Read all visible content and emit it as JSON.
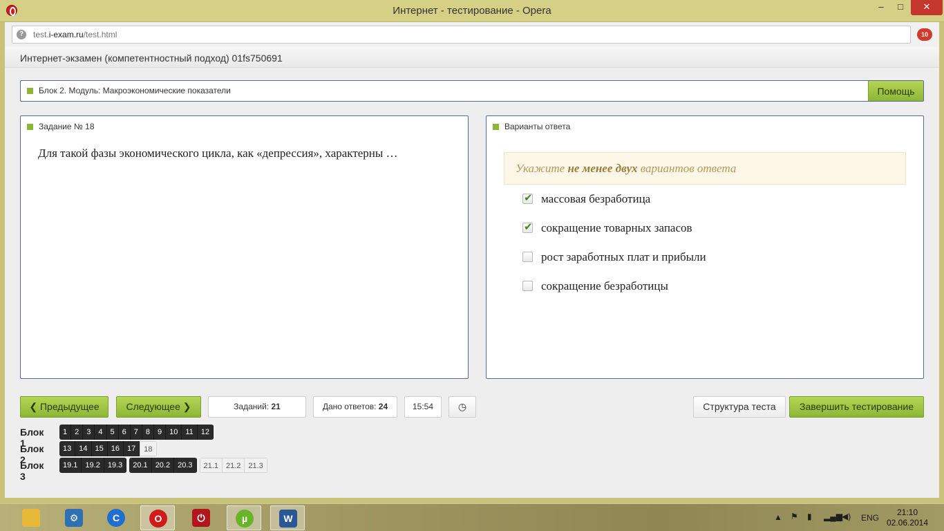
{
  "window": {
    "title": "Интернет - тестирование - Opera",
    "minimize": "–",
    "maximize": "□",
    "close": "✕"
  },
  "browser": {
    "url_prefix": "test.",
    "url_domain": "i-exam.ru",
    "url_path": "/test.html",
    "extension_badge": "10"
  },
  "page": {
    "header": "Интернет-экзамен (компетентностный подход) 01fs750691",
    "block_title": "Блок 2. Модуль: Макроэкономические показатели",
    "help_label": "Помощь",
    "task_title": "Задание № 18",
    "task_text": "Для такой фазы экономического цикла, как «депрессия», характерны …",
    "answers_title": "Варианты ответа",
    "hint_pre": "Укажите ",
    "hint_bold": "не менее двух",
    "hint_post": " вариантов ответа",
    "options": [
      {
        "label": "массовая безработица",
        "checked": true
      },
      {
        "label": "сокращение товарных запасов",
        "checked": true
      },
      {
        "label": "рост заработных плат и прибыли",
        "checked": false
      },
      {
        "label": "сокращение безработицы",
        "checked": false
      }
    ]
  },
  "controls": {
    "prev_label": "Предыдущее",
    "next_label": "Следующее",
    "tasks_label": "Заданий:",
    "tasks_count": "21",
    "answered_label": "Дано ответов:",
    "answered_count": "24",
    "timer": "15:54",
    "structure_label": "Структура теста",
    "finish_label": "Завершить тестирование"
  },
  "navigation": [
    {
      "label": "Блок 1",
      "groups": [
        [
          {
            "n": "1",
            "done": true
          },
          {
            "n": "2",
            "done": true
          },
          {
            "n": "3",
            "done": true
          },
          {
            "n": "4",
            "done": true
          },
          {
            "n": "5",
            "done": true
          },
          {
            "n": "6",
            "done": true
          },
          {
            "n": "7",
            "done": true
          },
          {
            "n": "8",
            "done": true
          },
          {
            "n": "9",
            "done": true
          },
          {
            "n": "10",
            "done": true
          },
          {
            "n": "11",
            "done": true
          },
          {
            "n": "12",
            "done": true
          }
        ]
      ]
    },
    {
      "label": "Блок 2",
      "groups": [
        [
          {
            "n": "13",
            "done": true
          },
          {
            "n": "14",
            "done": true
          },
          {
            "n": "15",
            "done": true
          },
          {
            "n": "16",
            "done": true
          },
          {
            "n": "17",
            "done": true
          },
          {
            "n": "18",
            "done": false
          }
        ]
      ]
    },
    {
      "label": "Блок 3",
      "groups": [
        [
          {
            "n": "19.1",
            "done": true
          },
          {
            "n": "19.2",
            "done": true
          },
          {
            "n": "19.3",
            "done": true
          }
        ],
        [
          {
            "n": "20.1",
            "done": true
          },
          {
            "n": "20.2",
            "done": true
          },
          {
            "n": "20.3",
            "done": true
          }
        ],
        [
          {
            "n": "21.1",
            "done": false
          },
          {
            "n": "21.2",
            "done": false
          },
          {
            "n": "21.3",
            "done": false
          }
        ]
      ]
    }
  ],
  "taskbar": {
    "apps": [
      {
        "name": "file-explorer-icon",
        "glyph": "",
        "color": "#e8b838"
      },
      {
        "name": "control-panel-icon",
        "glyph": "⚙",
        "color": "#2f6fb3"
      },
      {
        "name": "ccleaner-icon",
        "glyph": "C",
        "color": "#1e6fd1"
      },
      {
        "name": "opera-icon",
        "glyph": "O",
        "color": "#d01b1b"
      },
      {
        "name": "power-icon",
        "glyph": "⏻",
        "color": "#b0161c"
      },
      {
        "name": "utorrent-icon",
        "glyph": "µ",
        "color": "#6ab42a"
      },
      {
        "name": "word-icon",
        "glyph": "W",
        "color": "#2b5797"
      }
    ],
    "language": "ENG",
    "time": "21:10",
    "date": "02.06.2014"
  }
}
